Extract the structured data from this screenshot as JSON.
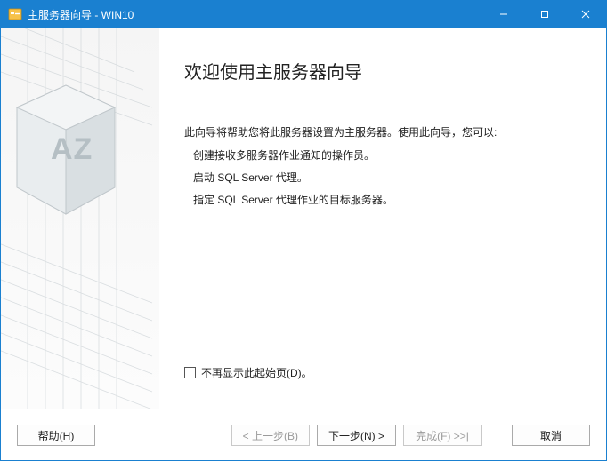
{
  "titlebar": {
    "title": "主服务器向导 - WIN10"
  },
  "sidebar": {
    "badge": "AZ"
  },
  "main": {
    "heading": "欢迎使用主服务器向导",
    "intro": "此向导将帮助您将此服务器设置为主服务器。使用此向导，您可以:",
    "bullets": [
      "创建接收多服务器作业通知的操作员。",
      "启动 SQL Server 代理。",
      "指定 SQL Server 代理作业的目标服务器。"
    ],
    "checkbox_label": "不再显示此起始页(D)。"
  },
  "buttons": {
    "help": "帮助(H)",
    "back": "< 上一步(B)",
    "next": "下一步(N) >",
    "finish": "完成(F) >>|",
    "cancel": "取消"
  }
}
